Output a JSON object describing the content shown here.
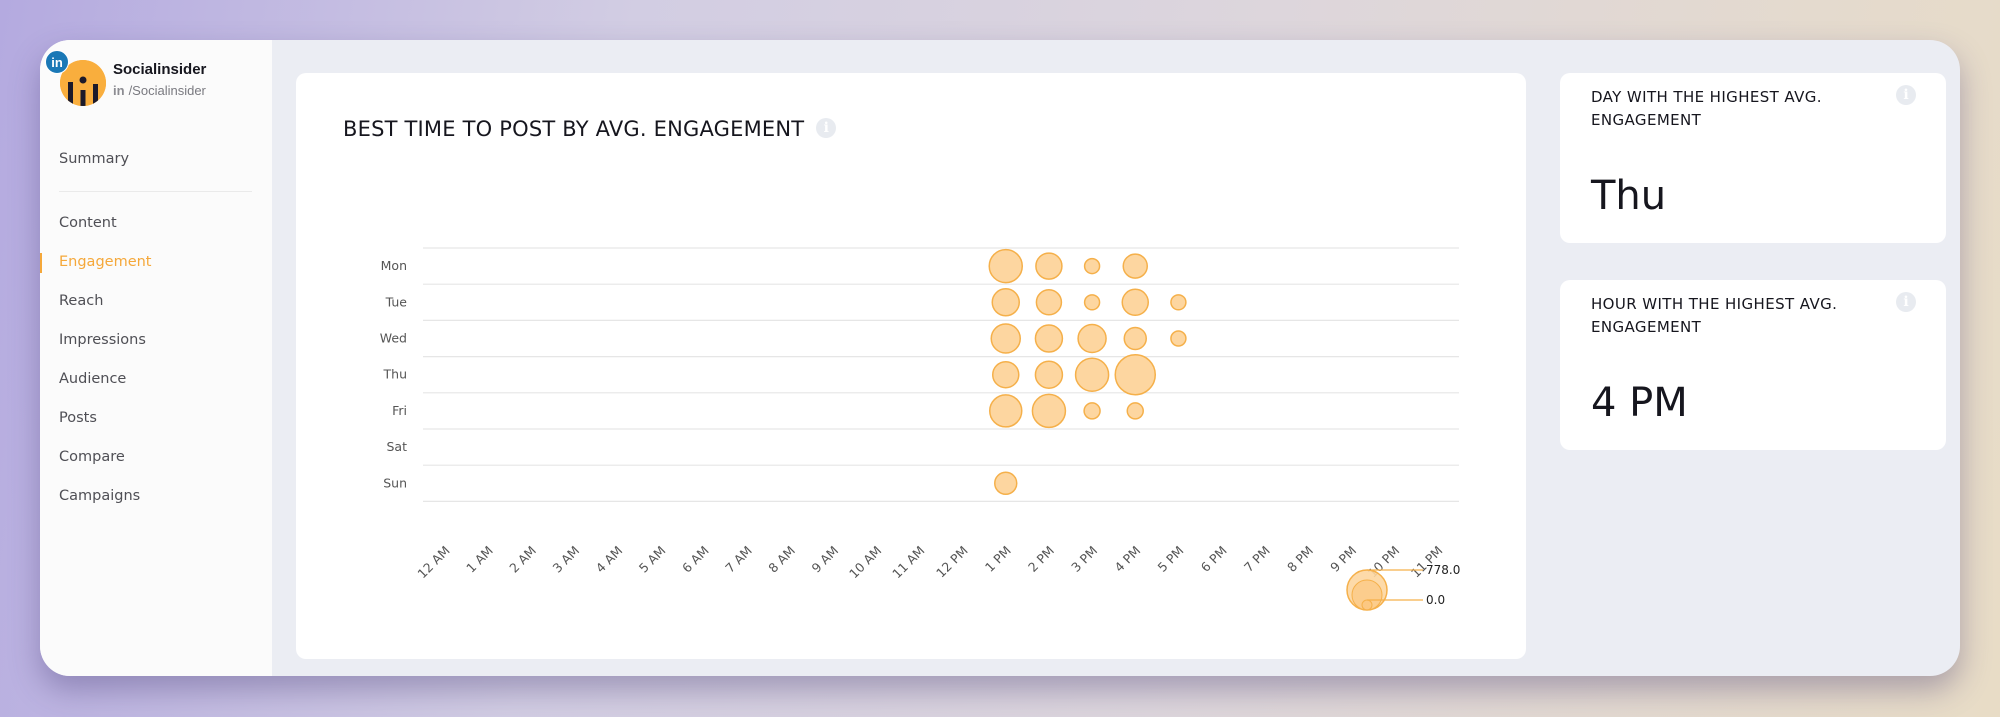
{
  "profile": {
    "network_badge": "in",
    "name": "Socialinsider",
    "handle_network": "in",
    "handle": "/Socialinsider"
  },
  "nav": {
    "items": [
      {
        "label": "Summary",
        "active": false
      },
      {
        "label": "Content",
        "active": false
      },
      {
        "label": "Engagement",
        "active": true
      },
      {
        "label": "Reach",
        "active": false
      },
      {
        "label": "Impressions",
        "active": false
      },
      {
        "label": "Audience",
        "active": false
      },
      {
        "label": "Posts",
        "active": false
      },
      {
        "label": "Compare",
        "active": false
      },
      {
        "label": "Campaigns",
        "active": false
      }
    ]
  },
  "colors": {
    "accent": "#f5a83a",
    "bubble_fill": "#fdd6a0",
    "bubble_stroke": "#f5b04a",
    "grid": "#e6e6e6",
    "text": "#16161e"
  },
  "main_card": {
    "title": "BEST TIME TO POST BY AVG. ENGAGEMENT",
    "info_icon": "info-icon"
  },
  "side_cards": [
    {
      "title": "DAY WITH THE HIGHEST AVG. ENGAGEMENT",
      "value": "Thu",
      "info_icon": "info-icon"
    },
    {
      "title": "HOUR WITH THE HIGHEST AVG. ENGAGEMENT",
      "value": "4 PM",
      "info_icon": "info-icon"
    }
  ],
  "chart_data": {
    "type": "scatter",
    "subtype": "bubble",
    "title": "BEST TIME TO POST BY AVG. ENGAGEMENT",
    "xlabel": "",
    "ylabel": "",
    "x_categories": [
      "12 AM",
      "1 AM",
      "2 AM",
      "3 AM",
      "4 AM",
      "5 AM",
      "6 AM",
      "7 AM",
      "8 AM",
      "9 AM",
      "10 AM",
      "11 AM",
      "12 PM",
      "1 PM",
      "2 PM",
      "3 PM",
      "4 PM",
      "5 PM",
      "6 PM",
      "7 PM",
      "8 PM",
      "9 PM",
      "10 PM",
      "11 PM"
    ],
    "y_categories": [
      "Mon",
      "Tue",
      "Wed",
      "Thu",
      "Fri",
      "Sat",
      "Sun"
    ],
    "grid": true,
    "size_legend": {
      "max": "778.0",
      "min": "0.0",
      "placement": "bottom-right"
    },
    "points": [
      {
        "day": "Mon",
        "hour": "1 PM",
        "value": 530
      },
      {
        "day": "Mon",
        "hour": "2 PM",
        "value": 329
      },
      {
        "day": "Mon",
        "hour": "3 PM",
        "value": 109
      },
      {
        "day": "Mon",
        "hour": "4 PM",
        "value": 280
      },
      {
        "day": "Tue",
        "hour": "1 PM",
        "value": 354
      },
      {
        "day": "Tue",
        "hour": "2 PM",
        "value": 304
      },
      {
        "day": "Tue",
        "hour": "3 PM",
        "value": 109
      },
      {
        "day": "Tue",
        "hour": "4 PM",
        "value": 329
      },
      {
        "day": "Tue",
        "hour": "5 PM",
        "value": 109
      },
      {
        "day": "Wed",
        "hour": "1 PM",
        "value": 409
      },
      {
        "day": "Wed",
        "hour": "2 PM",
        "value": 354
      },
      {
        "day": "Wed",
        "hour": "3 PM",
        "value": 381
      },
      {
        "day": "Wed",
        "hour": "4 PM",
        "value": 235
      },
      {
        "day": "Wed",
        "hour": "5 PM",
        "value": 109
      },
      {
        "day": "Thu",
        "hour": "1 PM",
        "value": 329
      },
      {
        "day": "Thu",
        "hour": "2 PM",
        "value": 354
      },
      {
        "day": "Thu",
        "hour": "3 PM",
        "value": 530
      },
      {
        "day": "Thu",
        "hour": "4 PM",
        "value": 778
      },
      {
        "day": "Fri",
        "hour": "1 PM",
        "value": 498
      },
      {
        "day": "Fri",
        "hour": "2 PM",
        "value": 530
      },
      {
        "day": "Fri",
        "hour": "3 PM",
        "value": 124
      },
      {
        "day": "Fri",
        "hour": "4 PM",
        "value": 124
      },
      {
        "day": "Sun",
        "hour": "1 PM",
        "value": 235
      }
    ]
  }
}
